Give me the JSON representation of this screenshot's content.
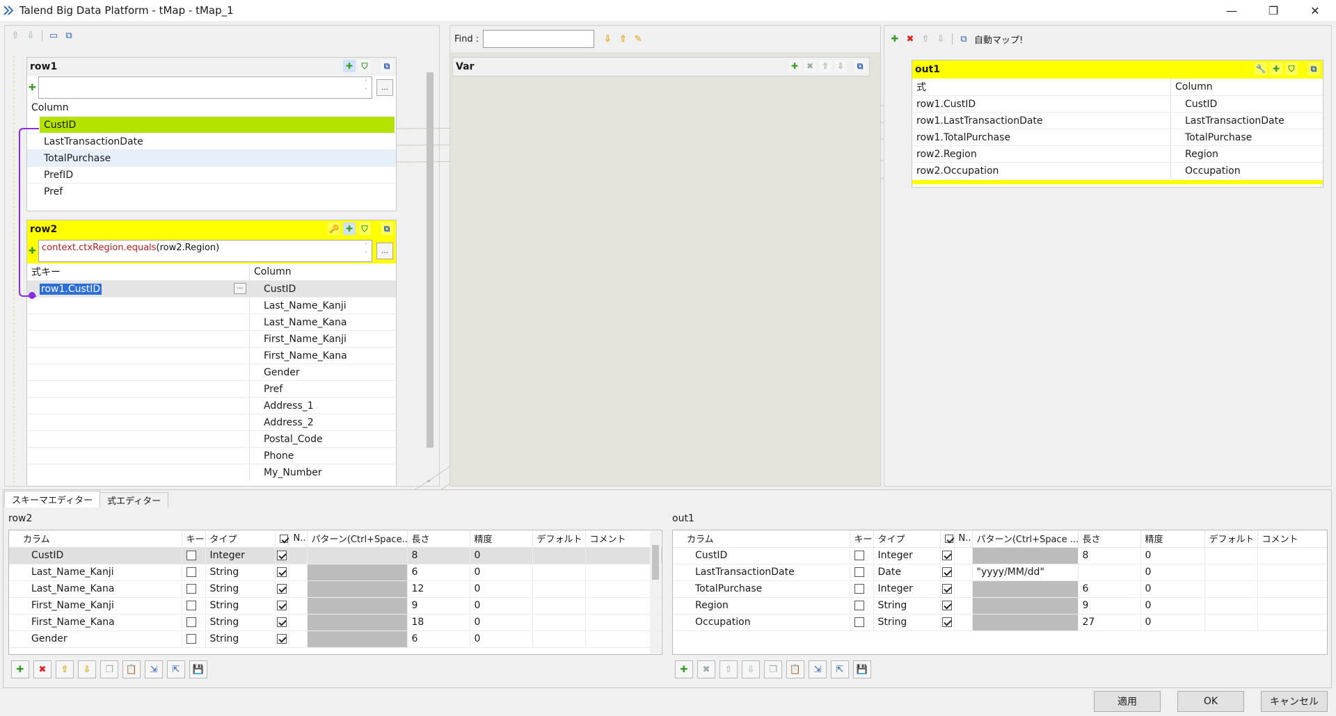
{
  "window": {
    "title": "Talend Big Data Platform - tMap - tMap_1",
    "minimize": "—",
    "restore": "❐",
    "close": "✕"
  },
  "var_panel": {
    "find_label": "Find :",
    "find_value": "",
    "var_title": "Var"
  },
  "out_toolbar": {
    "auto_map_label": "自動マップ!"
  },
  "row1": {
    "title": "row1",
    "column_header": "Column",
    "columns": [
      "CustID",
      "LastTransactionDate",
      "TotalPurchase",
      "PrefID",
      "Pref"
    ]
  },
  "row2": {
    "title": "row2",
    "filter_expr_keyword": "context.ctxRegion.equals",
    "filter_expr_rest": "(row2.Region)",
    "expr_key_header": "式キー",
    "column_header": "Column",
    "expr_key_value": "row1.CustID",
    "columns": [
      "CustID",
      "Last_Name_Kanji",
      "Last_Name_Kana",
      "First_Name_Kanji",
      "First_Name_Kana",
      "Gender",
      "Pref",
      "Address_1",
      "Address_2",
      "Postal_Code",
      "Phone",
      "My_Number"
    ]
  },
  "out1": {
    "title": "out1",
    "expr_header": "式",
    "column_header": "Column",
    "rows": [
      {
        "expr": "row1.CustID",
        "column": "CustID"
      },
      {
        "expr": "row1.LastTransactionDate",
        "column": "LastTransactionDate"
      },
      {
        "expr": "row1.TotalPurchase",
        "column": "TotalPurchase"
      },
      {
        "expr": "row2.Region",
        "column": "Region"
      },
      {
        "expr": "row2.Occupation",
        "column": "Occupation"
      }
    ]
  },
  "tabs": [
    "スキーマエディター",
    "式エディター"
  ],
  "schema_headers": [
    "カラム",
    "キー",
    "タイプ",
    "✓",
    "N..",
    "パターン(Ctrl+Space...",
    "長さ",
    "精度",
    "デフォルト",
    "コメント"
  ],
  "schema_headers_out": [
    "カラム",
    "キー",
    "タイプ",
    "✓",
    "N..",
    "パターン(Ctrl+Space ...",
    "長さ",
    "精度",
    "デフォルト",
    "コメント"
  ],
  "schema_left": {
    "label": "row2",
    "rows": [
      {
        "name": "CustID",
        "key": false,
        "type": "Integer",
        "nullable": true,
        "pattern": "",
        "length": "8",
        "precision": "0"
      },
      {
        "name": "Last_Name_Kanji",
        "key": false,
        "type": "String",
        "nullable": true,
        "pattern": "",
        "length": "6",
        "precision": "0"
      },
      {
        "name": "Last_Name_Kana",
        "key": false,
        "type": "String",
        "nullable": true,
        "pattern": "",
        "length": "12",
        "precision": "0"
      },
      {
        "name": "First_Name_Kanji",
        "key": false,
        "type": "String",
        "nullable": true,
        "pattern": "",
        "length": "9",
        "precision": "0"
      },
      {
        "name": "First_Name_Kana",
        "key": false,
        "type": "String",
        "nullable": true,
        "pattern": "",
        "length": "18",
        "precision": "0"
      },
      {
        "name": "Gender",
        "key": false,
        "type": "String",
        "nullable": true,
        "pattern": "",
        "length": "6",
        "precision": "0"
      }
    ]
  },
  "schema_right": {
    "label": "out1",
    "rows": [
      {
        "name": "CustID",
        "key": false,
        "type": "Integer",
        "nullable": true,
        "pattern": "",
        "length": "8",
        "precision": "0"
      },
      {
        "name": "LastTransactionDate",
        "key": false,
        "type": "Date",
        "nullable": true,
        "pattern": "\"yyyy/MM/dd\"",
        "length": "",
        "precision": "0"
      },
      {
        "name": "TotalPurchase",
        "key": false,
        "type": "Integer",
        "nullable": true,
        "pattern": "",
        "length": "6",
        "precision": "0"
      },
      {
        "name": "Region",
        "key": false,
        "type": "String",
        "nullable": true,
        "pattern": "",
        "length": "9",
        "precision": "0"
      },
      {
        "name": "Occupation",
        "key": false,
        "type": "String",
        "nullable": true,
        "pattern": "",
        "length": "27",
        "precision": "0"
      }
    ]
  },
  "buttons": {
    "apply": "適用",
    "ok": "OK",
    "cancel": "キャンセル"
  },
  "colors": {
    "selected_row": "#b5e300",
    "output_header": "#ffff00",
    "link_purple": "#8a2be2"
  }
}
